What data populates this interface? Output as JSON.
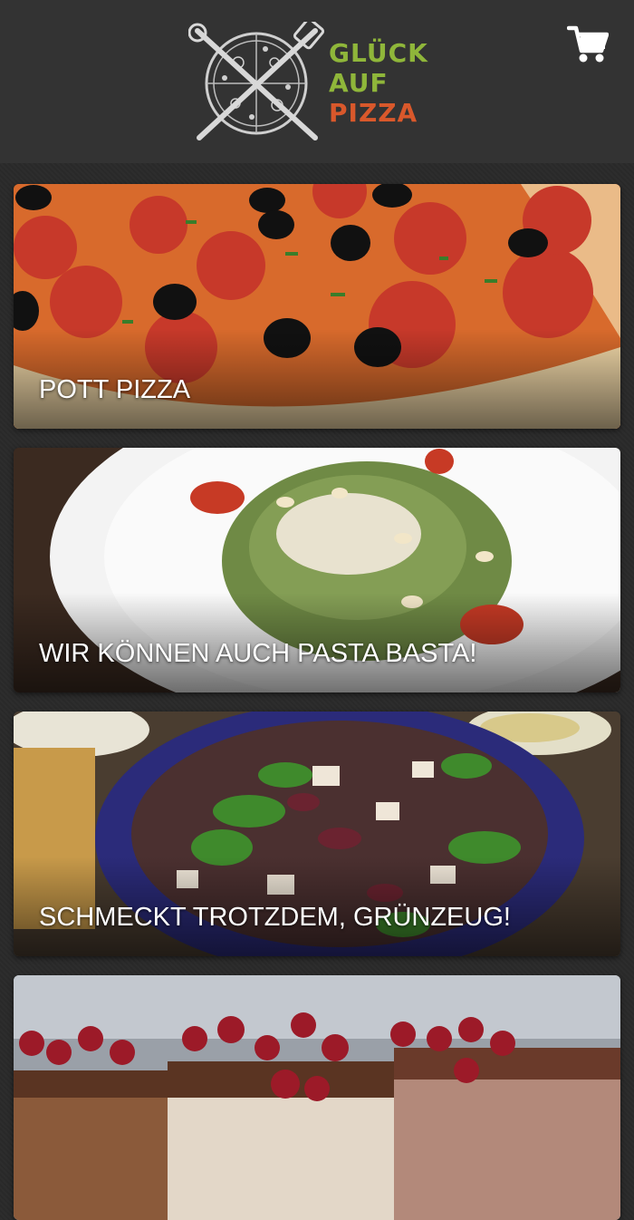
{
  "header": {
    "brand": {
      "line1": "GLÜCK",
      "line2": "AUF",
      "line3": "PIZZA"
    },
    "cart_icon": "shopping-cart-icon",
    "colors": {
      "brand_green": "#8fb63a",
      "brand_orange": "#d9582b",
      "header_bg": "#333333"
    }
  },
  "categories": [
    {
      "title": "POTT PIZZA",
      "image": "pizza-photo"
    },
    {
      "title": "WIR KÖNNEN AUCH PASTA BASTA!",
      "image": "pasta-photo"
    },
    {
      "title": "SCHMECKT TROTZDEM, GRÜNZEUG!",
      "image": "salad-photo"
    },
    {
      "title": "",
      "image": "dessert-photo"
    }
  ]
}
